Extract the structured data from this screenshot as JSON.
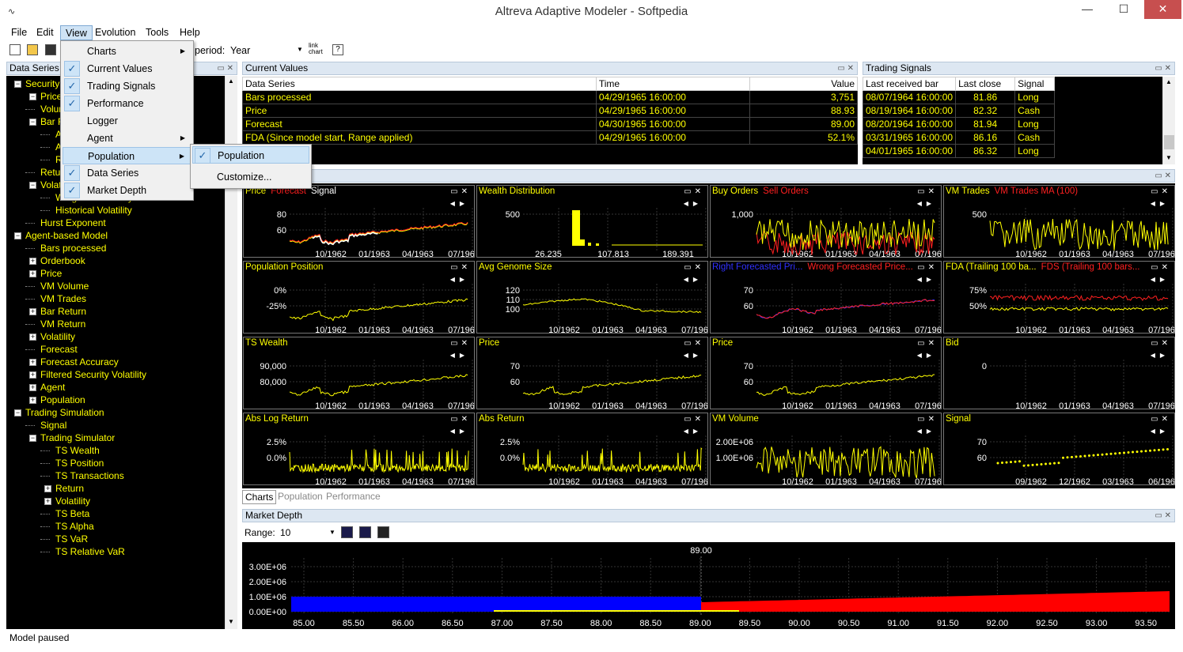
{
  "window": {
    "title": "Altreva Adaptive Modeler - Softpedia",
    "minimize": "—",
    "maximize": "☐",
    "close": "✕"
  },
  "menubar": [
    "File",
    "Edit",
    "View",
    "Evolution",
    "Tools",
    "Help"
  ],
  "toolbar": {
    "period_label": "period:",
    "period_value": "Year",
    "link_chart": "link chart"
  },
  "view_menu": {
    "items": [
      {
        "label": "Charts",
        "checked": false,
        "submenu": true
      },
      {
        "label": "Current Values",
        "checked": true,
        "submenu": false
      },
      {
        "label": "Trading Signals",
        "checked": true,
        "submenu": false
      },
      {
        "label": "Performance",
        "checked": true,
        "submenu": false
      },
      {
        "label": "Logger",
        "checked": false,
        "submenu": false
      },
      {
        "label": "Agent",
        "checked": false,
        "submenu": true
      },
      {
        "label": "Population",
        "checked": false,
        "submenu": true
      },
      {
        "label": "Data Series",
        "checked": true,
        "submenu": false
      },
      {
        "label": "Market Depth",
        "checked": true,
        "submenu": false
      }
    ],
    "sub_items": [
      "Population",
      "Customize..."
    ]
  },
  "data_series_panel": {
    "title": "Data Series",
    "tree": [
      {
        "label": "Security",
        "level": 0,
        "box": "−"
      },
      {
        "label": "Price",
        "level": 1,
        "box": "−"
      },
      {
        "label": "Volume",
        "level": 1,
        "box": ""
      },
      {
        "label": "Bar Return",
        "level": 1,
        "box": "−"
      },
      {
        "label": "Abs Return",
        "level": 2,
        "box": ""
      },
      {
        "label": "Abs Log Return",
        "level": 2,
        "box": ""
      },
      {
        "label": "Return Distribution",
        "level": 2,
        "box": ""
      },
      {
        "label": "Return",
        "level": 1,
        "box": ""
      },
      {
        "label": "Volatility",
        "level": 1,
        "box": "−"
      },
      {
        "label": "Weighted Volatility",
        "level": 2,
        "box": ""
      },
      {
        "label": "Historical Volatility",
        "level": 2,
        "box": ""
      },
      {
        "label": "Hurst Exponent",
        "level": 1,
        "box": ""
      },
      {
        "label": "Agent-based Model",
        "level": 0,
        "box": "−"
      },
      {
        "label": "Bars processed",
        "level": 1,
        "box": ""
      },
      {
        "label": "Orderbook",
        "level": 1,
        "box": "+"
      },
      {
        "label": "Price",
        "level": 1,
        "box": "+"
      },
      {
        "label": "VM Volume",
        "level": 1,
        "box": ""
      },
      {
        "label": "VM Trades",
        "level": 1,
        "box": ""
      },
      {
        "label": "Bar Return",
        "level": 1,
        "box": "+"
      },
      {
        "label": "VM Return",
        "level": 1,
        "box": ""
      },
      {
        "label": "Volatility",
        "level": 1,
        "box": "+"
      },
      {
        "label": "Forecast",
        "level": 1,
        "box": ""
      },
      {
        "label": "Forecast Accuracy",
        "level": 1,
        "box": "+"
      },
      {
        "label": "Filtered Security Volatility",
        "level": 1,
        "box": "+"
      },
      {
        "label": "Agent",
        "level": 1,
        "box": "+"
      },
      {
        "label": "Population",
        "level": 1,
        "box": "+"
      },
      {
        "label": "Trading Simulation",
        "level": 0,
        "box": "−"
      },
      {
        "label": "Signal",
        "level": 1,
        "box": ""
      },
      {
        "label": "Trading Simulator",
        "level": 1,
        "box": "−"
      },
      {
        "label": "TS Wealth",
        "level": 2,
        "box": ""
      },
      {
        "label": "TS Position",
        "level": 2,
        "box": ""
      },
      {
        "label": "TS Transactions",
        "level": 2,
        "box": ""
      },
      {
        "label": "Return",
        "level": 2,
        "box": "+"
      },
      {
        "label": "Volatility",
        "level": 2,
        "box": "+"
      },
      {
        "label": "TS Beta",
        "level": 2,
        "box": ""
      },
      {
        "label": "TS Alpha",
        "level": 2,
        "box": ""
      },
      {
        "label": "TS VaR",
        "level": 2,
        "box": ""
      },
      {
        "label": "TS Relative VaR",
        "level": 2,
        "box": ""
      }
    ]
  },
  "current_values": {
    "title": "Current Values",
    "columns": [
      "Data Series",
      "Time",
      "Value"
    ],
    "rows": [
      [
        "Bars processed",
        "04/29/1965 16:00:00",
        "3,751"
      ],
      [
        "Price",
        "04/29/1965 16:00:00",
        "88.93"
      ],
      [
        "Forecast",
        "04/30/1965 16:00:00",
        "89.00"
      ],
      [
        "FDA (Since model start, Range applied)",
        "04/29/1965 16:00:00",
        "52.1%"
      ]
    ]
  },
  "trading_signals": {
    "title": "Trading Signals",
    "columns": [
      "Last received bar",
      "Last close",
      "Signal"
    ],
    "rows": [
      [
        "08/07/1964 16:00:00",
        "81.86",
        "Long"
      ],
      [
        "08/19/1964 16:00:00",
        "82.32",
        "Cash"
      ],
      [
        "08/20/1964 16:00:00",
        "81.94",
        "Long"
      ],
      [
        "03/31/1965 16:00:00",
        "86.16",
        "Cash"
      ],
      [
        "04/01/1965 16:00:00",
        "86.32",
        "Long"
      ]
    ]
  },
  "charts": [
    {
      "titles": [
        [
          "Price",
          "#ffff00"
        ],
        [
          "Forecast",
          "#ff2020"
        ],
        [
          "Signal",
          "#ffffff"
        ]
      ],
      "yticks": [
        "80",
        "60"
      ],
      "xticks": [
        "10/1962",
        "01/1963",
        "04/1963",
        "07/196"
      ],
      "kind": "price"
    },
    {
      "titles": [
        [
          "Wealth Distribution",
          "#ffff00"
        ]
      ],
      "yticks": [
        "500"
      ],
      "xticks": [
        "26,235",
        "107,813",
        "189,391"
      ],
      "kind": "hist"
    },
    {
      "titles": [
        [
          "Buy Orders",
          "#ffff00"
        ],
        [
          "Sell Orders",
          "#ff2020"
        ]
      ],
      "yticks": [
        "1,000"
      ],
      "xticks": [
        "10/1962",
        "01/1963",
        "04/1963",
        "07/196"
      ],
      "kind": "orders"
    },
    {
      "titles": [
        [
          "VM Trades",
          "#ffff00"
        ],
        [
          "VM Trades MA (100)",
          "#ff2020"
        ]
      ],
      "yticks": [
        "500"
      ],
      "xticks": [
        "10/1962",
        "01/1963",
        "04/1963",
        "07/196"
      ],
      "kind": "noisy"
    },
    {
      "titles": [
        [
          "Population Position",
          "#ffff00"
        ]
      ],
      "yticks": [
        "0%",
        "-25%"
      ],
      "xticks": [
        "10/1962",
        "01/1963",
        "04/1963",
        "07/196"
      ],
      "kind": "rise"
    },
    {
      "titles": [
        [
          "Avg Genome Size",
          "#ffff00"
        ]
      ],
      "yticks": [
        "120",
        "110",
        "100"
      ],
      "xticks": [
        "10/1962",
        "01/1963",
        "04/1963",
        "07/196"
      ],
      "kind": "hump"
    },
    {
      "titles": [
        [
          "Right Forecasted Pri...",
          "#3030ff"
        ],
        [
          "Wrong Forecasted Price...",
          "#ff2020"
        ]
      ],
      "yticks": [
        "70",
        "60"
      ],
      "xticks": [
        "10/1962",
        "01/1963",
        "04/1963",
        "07/196"
      ],
      "kind": "rightwrong"
    },
    {
      "titles": [
        [
          "FDA (Trailing 100 ba...",
          "#ffff00"
        ],
        [
          "FDS (Trailing 100 bars...",
          "#ff2020"
        ]
      ],
      "yticks": [
        "75%",
        "50%"
      ],
      "xticks": [
        "10/1962",
        "01/1963",
        "04/1963",
        "07/196"
      ],
      "kind": "fda"
    },
    {
      "titles": [
        [
          "TS Wealth",
          "#ffff00"
        ]
      ],
      "yticks": [
        "90,000",
        "80,000"
      ],
      "xticks": [
        "10/1962",
        "01/1963",
        "04/1963",
        "07/196"
      ],
      "kind": "rise"
    },
    {
      "titles": [
        [
          "Price",
          "#ffff00"
        ]
      ],
      "yticks": [
        "70",
        "60"
      ],
      "xticks": [
        "10/1962",
        "01/1963",
        "04/1963",
        "07/196"
      ],
      "kind": "rise"
    },
    {
      "titles": [
        [
          "Price",
          "#ffff00"
        ]
      ],
      "yticks": [
        "70",
        "60"
      ],
      "xticks": [
        "10/1962",
        "01/1963",
        "04/1963",
        "07/196"
      ],
      "kind": "rise"
    },
    {
      "titles": [
        [
          "Bid",
          "#ffff00"
        ]
      ],
      "yticks": [
        "0"
      ],
      "xticks": [
        "10/1962",
        "01/1963",
        "04/1963",
        "07/196"
      ],
      "kind": "none"
    },
    {
      "titles": [
        [
          "Abs Log Return",
          "#ffff00"
        ]
      ],
      "yticks": [
        "2.5%",
        "0.0%"
      ],
      "xticks": [
        "10/1962",
        "01/1963",
        "04/1963",
        "07/196"
      ],
      "kind": "spiky"
    },
    {
      "titles": [
        [
          "Abs Return",
          "#ffff00"
        ]
      ],
      "yticks": [
        "2.5%",
        "0.0%"
      ],
      "xticks": [
        "10/1962",
        "01/1963",
        "04/1963",
        "07/196"
      ],
      "kind": "spiky"
    },
    {
      "titles": [
        [
          "VM Volume",
          "#ffff00"
        ]
      ],
      "yticks": [
        "2.00E+06",
        "1.00E+06"
      ],
      "xticks": [
        "10/1962",
        "01/1963",
        "04/1963",
        "07/196"
      ],
      "kind": "noisy"
    },
    {
      "titles": [
        [
          "Signal",
          "#ffff00"
        ]
      ],
      "yticks": [
        "70",
        "60"
      ],
      "xticks": [
        "09/1962",
        "12/1962",
        "03/1963",
        "06/196"
      ],
      "kind": "dots"
    }
  ],
  "bottom_tabs": [
    "Charts",
    "Population",
    "Performance"
  ],
  "market_depth": {
    "title": "Market Depth",
    "range_label": "Range:",
    "range_value": "10",
    "center_label": "89.00",
    "yticks": [
      "3.00E+06",
      "2.00E+06",
      "1.00E+06",
      "0.00E+00"
    ],
    "xticks": [
      "85.00",
      "85.50",
      "86.00",
      "86.50",
      "87.00",
      "87.50",
      "88.00",
      "88.50",
      "89.00",
      "89.50",
      "90.00",
      "90.50",
      "91.00",
      "91.50",
      "92.00",
      "92.50",
      "93.00",
      "93.50"
    ],
    "bid_color": "#0000ff",
    "ask_color": "#ff0000"
  },
  "status": "Model paused",
  "watermark": "SOFTPEDIA"
}
